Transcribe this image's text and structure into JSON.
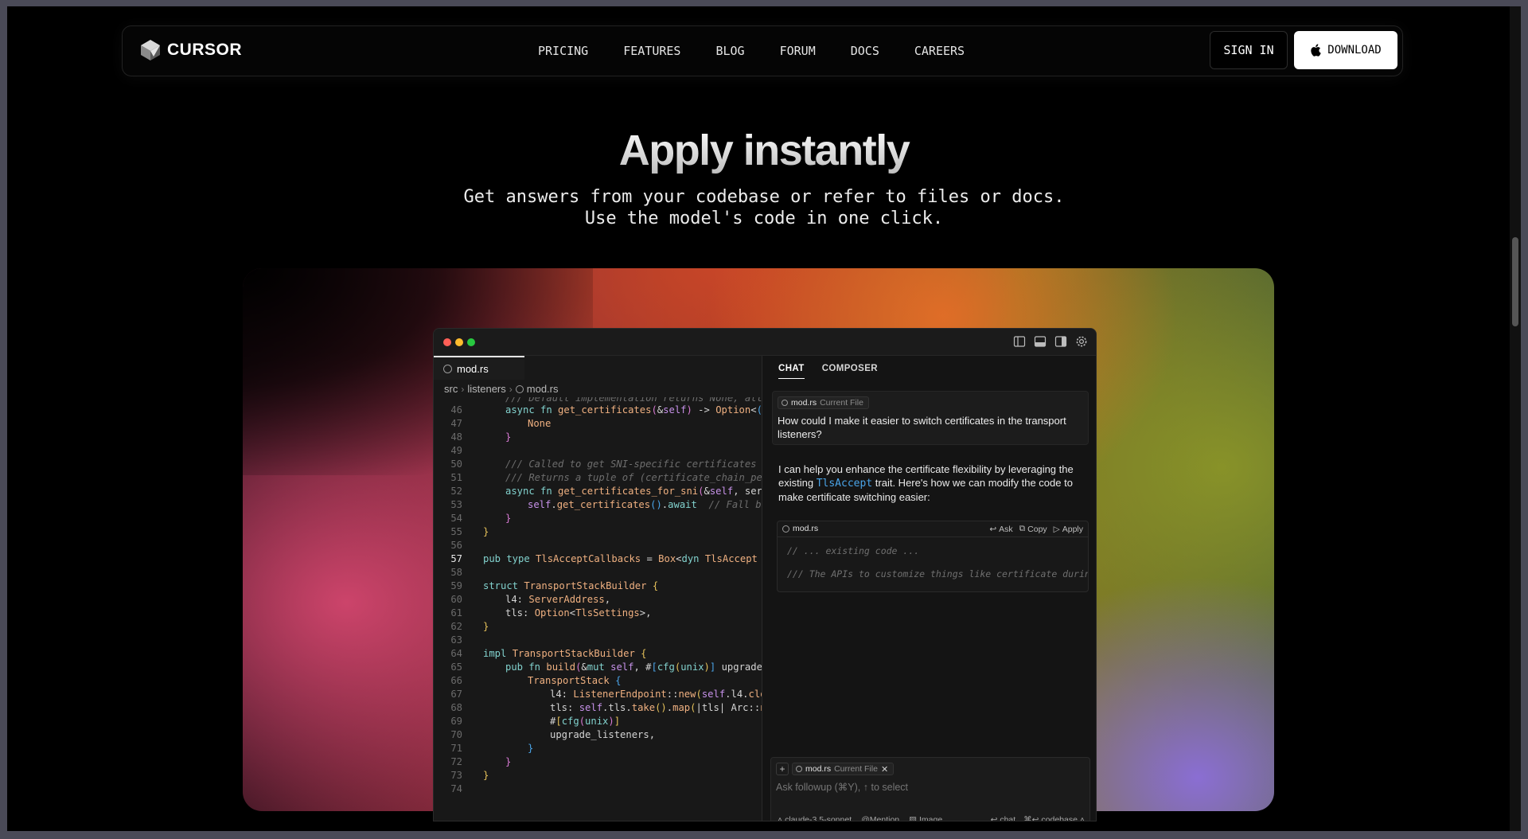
{
  "nav": {
    "brand": "CURSOR",
    "links": [
      "PRICING",
      "FEATURES",
      "BLOG",
      "FORUM",
      "DOCS",
      "CAREERS"
    ],
    "sign_in": "SIGN IN",
    "download": "DOWNLOAD"
  },
  "hero": {
    "title": "Apply instantly",
    "subtitle_line1": "Get answers from your codebase or refer to files or docs.",
    "subtitle_line2": "Use the model's code in one click."
  },
  "editor": {
    "tab_label": "mod.rs",
    "breadcrumb": [
      "src",
      "listeners",
      "mod.rs"
    ],
    "active_line": 57,
    "first_partial_line": "/// Default implementation returns None, allowing"
  },
  "chat": {
    "tabs": [
      "CHAT",
      "COMPOSER"
    ],
    "active_tab": "CHAT",
    "context_file": "mod.rs",
    "context_label": "Current File",
    "user_message": "How could I make it easier to switch certificates in the transport listeners?",
    "ai_text_before": "I can help you enhance the certificate flexibility by leveraging the existing",
    "ai_code_ref": "TlsAccept",
    "ai_text_after": "trait. Here's how we can modify the code to make certificate switching easier:",
    "code_block": {
      "file": "mod.rs",
      "actions": [
        "Ask",
        "Copy",
        "Apply"
      ],
      "lines": [
        "// ... existing code ...",
        "/// The APIs to customize things like certificate during TLS server side handshake"
      ]
    },
    "input": {
      "add": "+",
      "chip_file": "mod.rs",
      "chip_label": "Current File",
      "placeholder": "Ask followup (⌘Y), ↑ to select",
      "model": "claude-3.5-sonnet",
      "mention": "Mention",
      "image": "Image",
      "chat": "chat",
      "codebase": "codebase"
    }
  },
  "colors": {
    "accent_keyword": "#82d2ce",
    "accent_function": "#efb080",
    "accent_link": "#4aa4e8",
    "background": "#000000"
  },
  "icons": [
    "cursor-logo-icon",
    "apple-icon",
    "rust-file-icon",
    "layout-sidebar-icon",
    "layout-panel-icon",
    "layout-right-icon",
    "gear-icon"
  ]
}
